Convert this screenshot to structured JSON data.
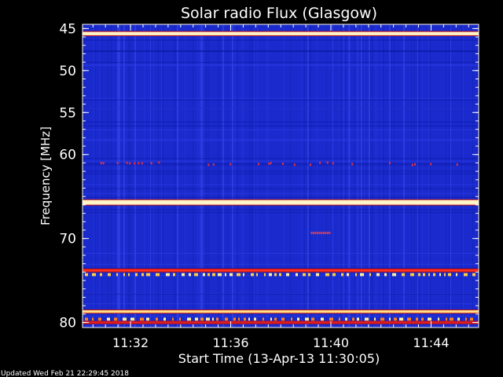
{
  "chart_data": {
    "type": "heatmap",
    "title": "Solar radio Flux (Glasgow)",
    "xlabel": "Start Time (13-Apr-13 11:30:05)",
    "ylabel": "Frequency [MHz]",
    "footer": "Updated Wed Feb 21 22:29:45 2018",
    "x_start_min": 0.083,
    "x_end_min": 15.9,
    "xticks": [
      {
        "label": "11:32",
        "min": 2
      },
      {
        "label": "11:36",
        "min": 6
      },
      {
        "label": "11:40",
        "min": 10
      },
      {
        "label": "11:44",
        "min": 14
      }
    ],
    "yticks": [
      {
        "label": "45",
        "mhz": 45
      },
      {
        "label": "50",
        "mhz": 50
      },
      {
        "label": "55",
        "mhz": 55
      },
      {
        "label": "60",
        "mhz": 60
      },
      {
        "label": "70",
        "mhz": 70
      },
      {
        "label": "80",
        "mhz": 80
      }
    ],
    "background_color": "#1a2acc",
    "features": [
      {
        "freq_mhz": 45.6,
        "width_mhz": 0.4,
        "color": "#fff4c8",
        "kind": "band"
      },
      {
        "freq_mhz": 65.7,
        "width_mhz": 0.55,
        "color": "#fff4c8",
        "kind": "band"
      },
      {
        "freq_mhz": 73.8,
        "width_mhz": 0.25,
        "color": "#ff3020",
        "kind": "band"
      },
      {
        "freq_mhz": 74.3,
        "width_mhz": 0.35,
        "color": "#ffd040",
        "kind": "dashes"
      },
      {
        "freq_mhz": 78.7,
        "width_mhz": 0.3,
        "color": "#ffe08a",
        "kind": "band"
      },
      {
        "freq_mhz": 79.6,
        "width_mhz": 0.35,
        "color": "#ff8020",
        "kind": "dashes"
      },
      {
        "freq_mhz": 80.0,
        "width_mhz": 0.2,
        "color": "#e02020",
        "kind": "band"
      }
    ]
  }
}
